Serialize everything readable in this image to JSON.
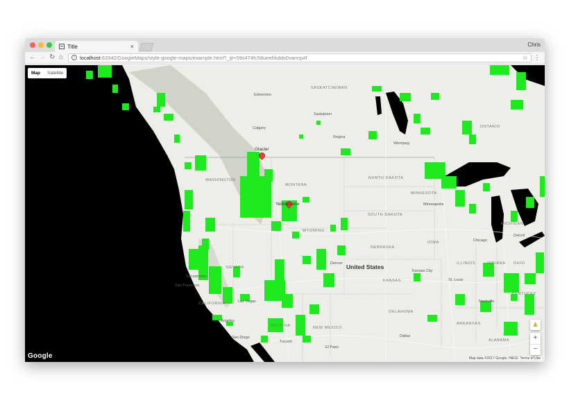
{
  "browser": {
    "tab_title": "Title",
    "user_name": "Chris",
    "url_host": "localhost",
    "url_rest": ":63342/GoogleMaps/style-google-maps/example.html?_ijt=59v474fc58ueehkdds0vannp4f",
    "icons": [
      "back-icon",
      "forward-icon",
      "reload-icon",
      "home-icon",
      "info-icon",
      "star-icon",
      "menu-icon"
    ]
  },
  "map": {
    "map_type_options": [
      "Map",
      "Satellite"
    ],
    "selected_map_type": "Map",
    "logo": "Google",
    "attribution": "Map data ©2017 Google, INEGI",
    "terms": "Terms of Use",
    "zoom_in": "+",
    "zoom_out": "−",
    "country_label": "United States",
    "markers": [
      "Glacier",
      "Yellowstone"
    ],
    "states": [
      "WASHINGTON",
      "MONTANA",
      "NORTH DAKOTA",
      "SOUTH DAKOTA",
      "MINNESOTA",
      "WYOMING",
      "NEBRASKA",
      "IOWA",
      "NEVADA",
      "KANSAS",
      "ILLINOIS",
      "INDIANA",
      "OHIO",
      "CALIFORNIA",
      "OKLAHOMA",
      "KENTUCKY",
      "ARIZONA",
      "NEW MEXICO",
      "ARKANSAS",
      "ALABAMA",
      "ONTARIO",
      "MICHIGAN",
      "SASKATCHEWAN"
    ],
    "cities": [
      "Edmonton",
      "Saskatoon",
      "Calgary",
      "Regina",
      "Winnipeg",
      "Minneapolis",
      "Chicago",
      "Detroit",
      "Denver",
      "Kansas City",
      "St. Louis",
      "Nashville",
      "Sacramento",
      "San Francisco",
      "Las Vegas",
      "Los Angeles",
      "San Diego",
      "Tucson",
      "El Paso",
      "Dallas"
    ],
    "colors": {
      "land": "#eceee7",
      "water": "#000000",
      "parks": "#1ee81e",
      "marker": "#e8453c"
    }
  }
}
